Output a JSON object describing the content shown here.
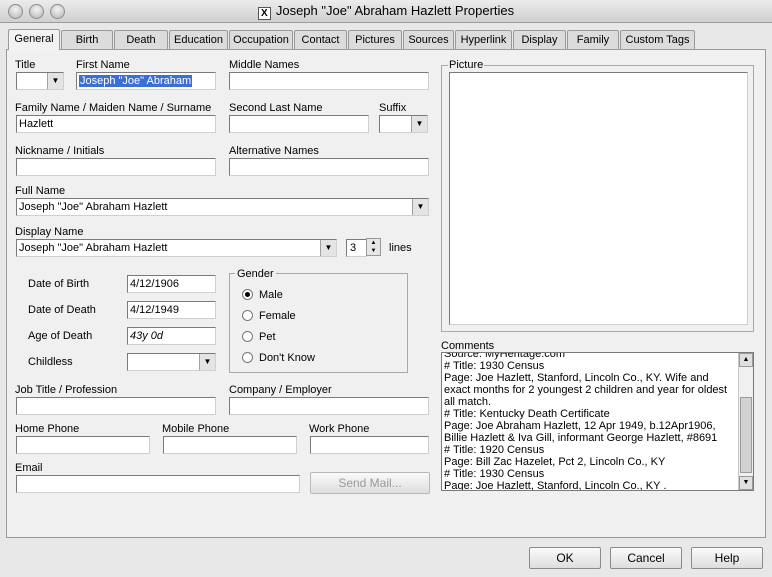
{
  "window": {
    "title": "Joseph \"Joe\" Abraham Hazlett Properties",
    "app_icon": "X"
  },
  "tabs": [
    "General",
    "Birth",
    "Death",
    "Education",
    "Occupation",
    "Contact",
    "Pictures",
    "Sources",
    "Hyperlink",
    "Display",
    "Family",
    "Custom Tags"
  ],
  "active_tab": "General",
  "fields": {
    "title": {
      "label": "Title",
      "value": ""
    },
    "first_name": {
      "label": "First Name",
      "value": "Joseph \"Joe\" Abraham"
    },
    "middle_names": {
      "label": "Middle Names",
      "value": ""
    },
    "family_name": {
      "label": "Family Name / Maiden Name / Surname",
      "value": "Hazlett"
    },
    "second_last_name": {
      "label": "Second Last Name",
      "value": ""
    },
    "suffix": {
      "label": "Suffix",
      "value": ""
    },
    "nickname": {
      "label": "Nickname / Initials",
      "value": ""
    },
    "alternative_names": {
      "label": "Alternative Names",
      "value": ""
    },
    "full_name": {
      "label": "Full Name",
      "value": "Joseph \"Joe\" Abraham Hazlett"
    },
    "display_name": {
      "label": "Display Name",
      "value": "Joseph \"Joe\" Abraham Hazlett",
      "lines": "3",
      "lines_label": "lines"
    },
    "date_of_birth": {
      "label": "Date of Birth",
      "value": "4/12/1906"
    },
    "date_of_death": {
      "label": "Date of Death",
      "value": "4/12/1949"
    },
    "age_of_death": {
      "label": "Age of Death",
      "value": "43y 0d"
    },
    "childless": {
      "label": "Childless",
      "value": ""
    },
    "job_title": {
      "label": "Job Title / Profession",
      "value": ""
    },
    "company": {
      "label": "Company / Employer",
      "value": ""
    },
    "home_phone": {
      "label": "Home Phone",
      "value": ""
    },
    "mobile_phone": {
      "label": "Mobile Phone",
      "value": ""
    },
    "work_phone": {
      "label": "Work Phone",
      "value": ""
    },
    "email": {
      "label": "Email",
      "value": ""
    }
  },
  "gender": {
    "label": "Gender",
    "options": [
      "Male",
      "Female",
      "Pet",
      "Don't Know"
    ],
    "selected": "Male"
  },
  "send_mail": "Send Mail...",
  "picture_label": "Picture",
  "comments": {
    "label": "Comments",
    "lines": [
      "Source: MyHeritage.com",
      "# Title: 1930 Census",
      "Page: Joe Hazlett, Stanford, Lincoln Co., KY. Wife and",
      "exact months for 2 youngest 2 children and year for oldest",
      "all match.",
      "# Title: Kentucky Death Certificate",
      "Page: Joe Abraham Hazlett, 12 Apr 1949, b.12Apr1906,",
      "Billie Hazlett & Iva Gill, informant George Hazlett, #8691",
      "# Title: 1920 Census",
      "Page: Bill Zac Hazelet, Pct 2, Lincoln Co., KY",
      "# Title: 1930 Census",
      "Page: Joe Hazlett, Stanford, Lincoln Co., KY ."
    ]
  },
  "buttons": {
    "ok": "OK",
    "cancel": "Cancel",
    "help": "Help"
  }
}
